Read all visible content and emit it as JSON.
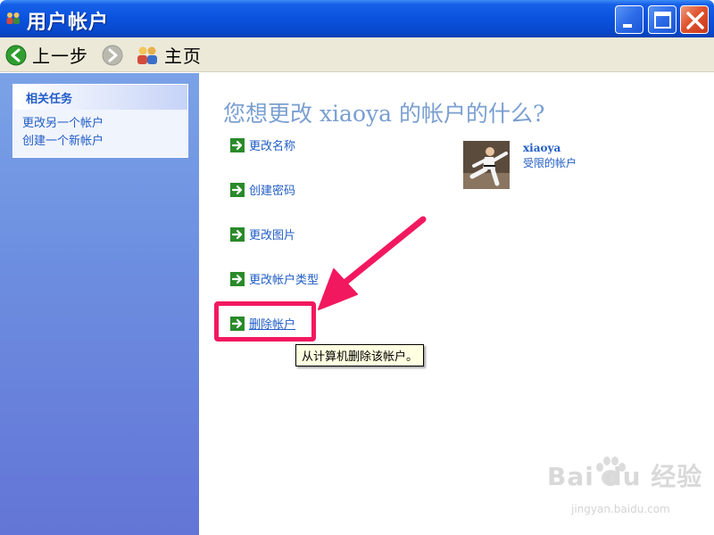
{
  "window": {
    "title": "用户帐户",
    "icon": "users-icon",
    "controls": [
      "minimize-icon",
      "maximize-icon",
      "close-icon"
    ]
  },
  "toolbar": {
    "back_label": "上一步",
    "home_label": "主页"
  },
  "sidebar": {
    "title": "相关任务",
    "items": [
      {
        "label": "更改另一个帐户"
      },
      {
        "label": "创建一个新帐户"
      }
    ]
  },
  "main": {
    "heading": "您想更改 xiaoya 的帐户的什么?",
    "actions": [
      {
        "label": "更改名称"
      },
      {
        "label": "创建密码"
      },
      {
        "label": "更改图片"
      },
      {
        "label": "更改帐户类型"
      },
      {
        "label": "删除帐户"
      }
    ],
    "tooltip": "从计算机删除该帐户。"
  },
  "user": {
    "name": "xiaoya",
    "type": "受限的帐户"
  },
  "watermark": {
    "brand": "Bai du 经验",
    "url": "jingyan.baidu.com"
  },
  "colors": {
    "titlebar": "#0a52de",
    "link": "#215dc6",
    "annotation": "#f2185f",
    "heading": "#7a9fd1"
  }
}
